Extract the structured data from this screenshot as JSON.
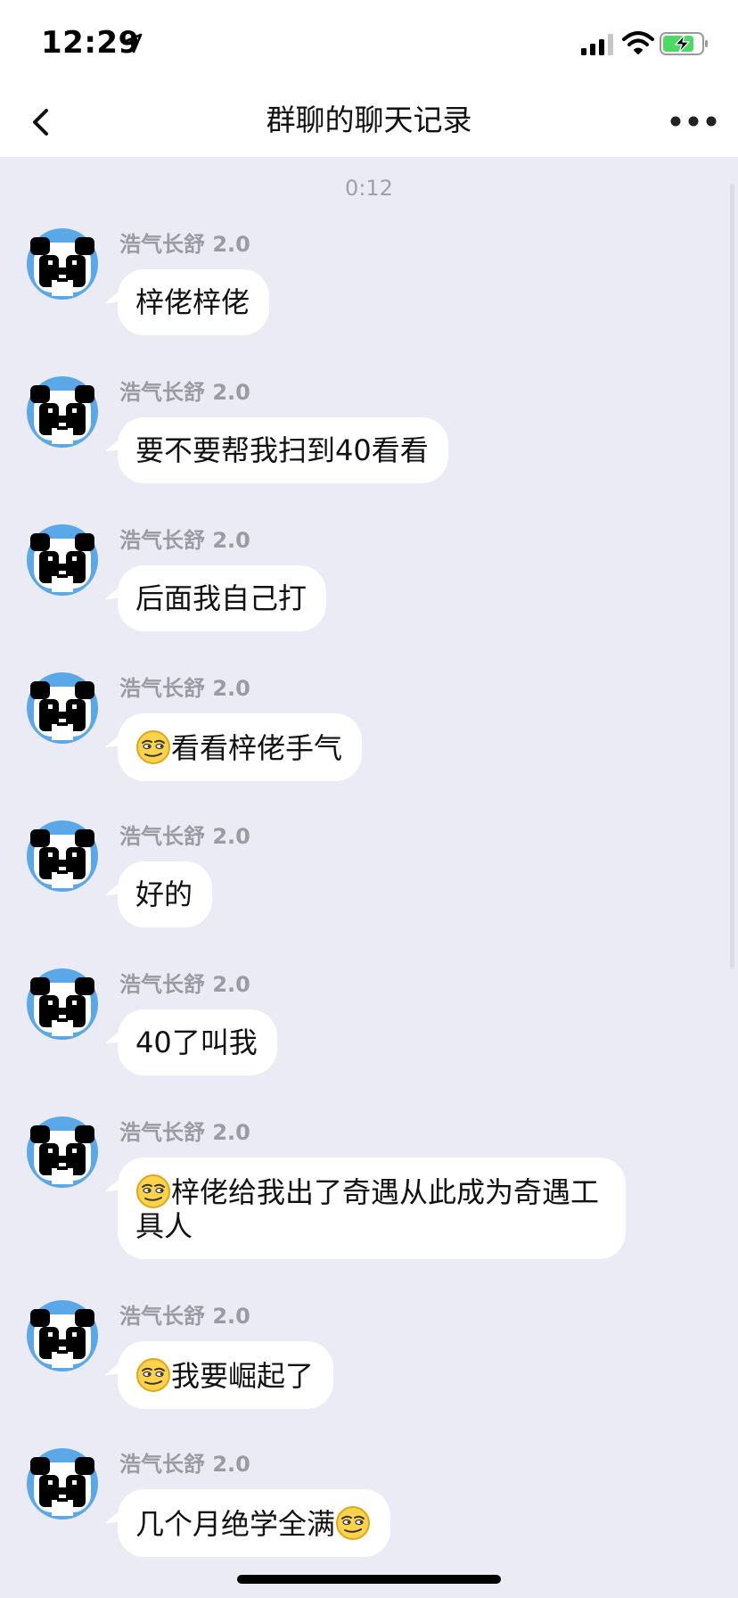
{
  "status_bar": {
    "time": "12:29"
  },
  "nav": {
    "title": "群聊的聊天记录"
  },
  "chat": {
    "timestamp": "0:12",
    "messages": [
      {
        "sender": "浩气长舒 2.0",
        "text": "梓佬梓佬",
        "emoji_before": false,
        "emoji_after": false
      },
      {
        "sender": "浩气长舒 2.0",
        "text": "要不要帮我扫到40看看",
        "emoji_before": false,
        "emoji_after": false
      },
      {
        "sender": "浩气长舒 2.0",
        "text": "后面我自己打",
        "emoji_before": false,
        "emoji_after": false
      },
      {
        "sender": "浩气长舒 2.0",
        "text": "看看梓佬手气",
        "emoji_before": true,
        "emoji_after": false
      },
      {
        "sender": "浩气长舒 2.0",
        "text": "好的",
        "emoji_before": false,
        "emoji_after": false
      },
      {
        "sender": "浩气长舒 2.0",
        "text": "40了叫我",
        "emoji_before": false,
        "emoji_after": false
      },
      {
        "sender": "浩气长舒 2.0",
        "text": "梓佬给我出了奇遇从此成为奇遇工具人",
        "emoji_before": true,
        "emoji_after": false
      },
      {
        "sender": "浩气长舒 2.0",
        "text": "我要崛起了",
        "emoji_before": true,
        "emoji_after": false
      },
      {
        "sender": "浩气长舒 2.0",
        "text": "几个月绝学全满",
        "emoji_before": false,
        "emoji_after": true
      }
    ]
  },
  "colors": {
    "background": "#ebebf6",
    "bubble": "#ffffff",
    "avatar_bg": "#5aa8e8"
  },
  "icons": [
    "location-arrow-icon",
    "signal-icon",
    "wifi-icon",
    "battery-charging-icon",
    "back-chevron-icon",
    "more-dots-icon",
    "panda-avatar",
    "smirk-emoji-icon"
  ]
}
